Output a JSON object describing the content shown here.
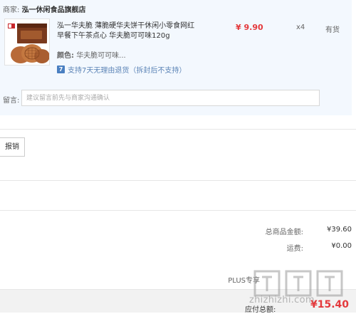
{
  "shop": {
    "label": "商家:",
    "name": "泓一休闲食品旗舰店"
  },
  "product": {
    "title": "泓一华夫脆 薄脆硬华夫饼干休闲小零食网红早餐下午茶点心 华夫脆可可味120g",
    "price": "¥ 9.90",
    "quantity": "x4",
    "stock": "有货",
    "color_label": "颜色:",
    "color_value": "华夫脆可可味...",
    "return_badge": "7",
    "return_text": "支持7天无理由退货（拆封后不支持）"
  },
  "message": {
    "label": "留言:",
    "placeholder": "建议留言前先与商家沟通确认"
  },
  "invoice": {
    "label": "报销"
  },
  "summary": {
    "goods_label": "总商品金额:",
    "goods_value": "¥39.60",
    "freight_label": "运费:",
    "freight_value": "¥0.00",
    "plus_label": "PLUS专享"
  },
  "total": {
    "label": "应付总额:",
    "value": "¥15.40"
  },
  "watermark": "zhizhizhi.com",
  "colors": {
    "accent": "#e4393c",
    "link": "#5b83b6",
    "panel": "#f3f8fe"
  }
}
